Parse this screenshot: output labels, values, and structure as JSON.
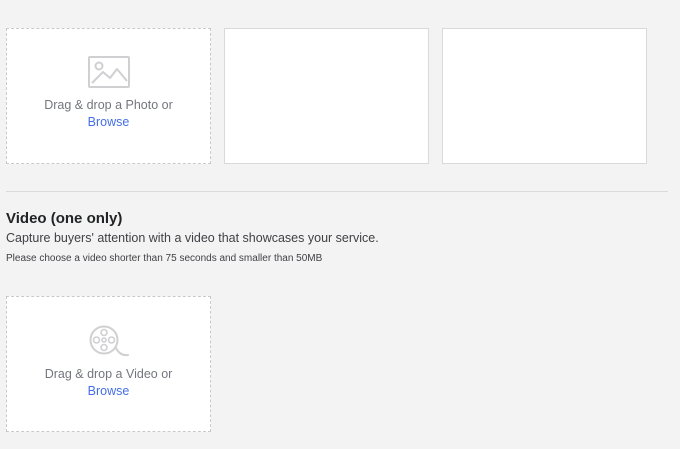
{
  "photos": {
    "drop_text": "Drag & drop a Photo or",
    "browse_label": "Browse",
    "icon": "image-icon"
  },
  "video": {
    "title": "Video (one only)",
    "description": "Capture buyers' attention with a video that showcases your service.",
    "note": "Please choose a video shorter than 75 seconds and smaller than 50MB",
    "drop_text": "Drag & drop a Video or",
    "browse_label": "Browse",
    "icon": "film-reel-icon"
  },
  "colors": {
    "link": "#446ee7",
    "background": "#f3f3f3",
    "muted_text": "#74767e"
  }
}
